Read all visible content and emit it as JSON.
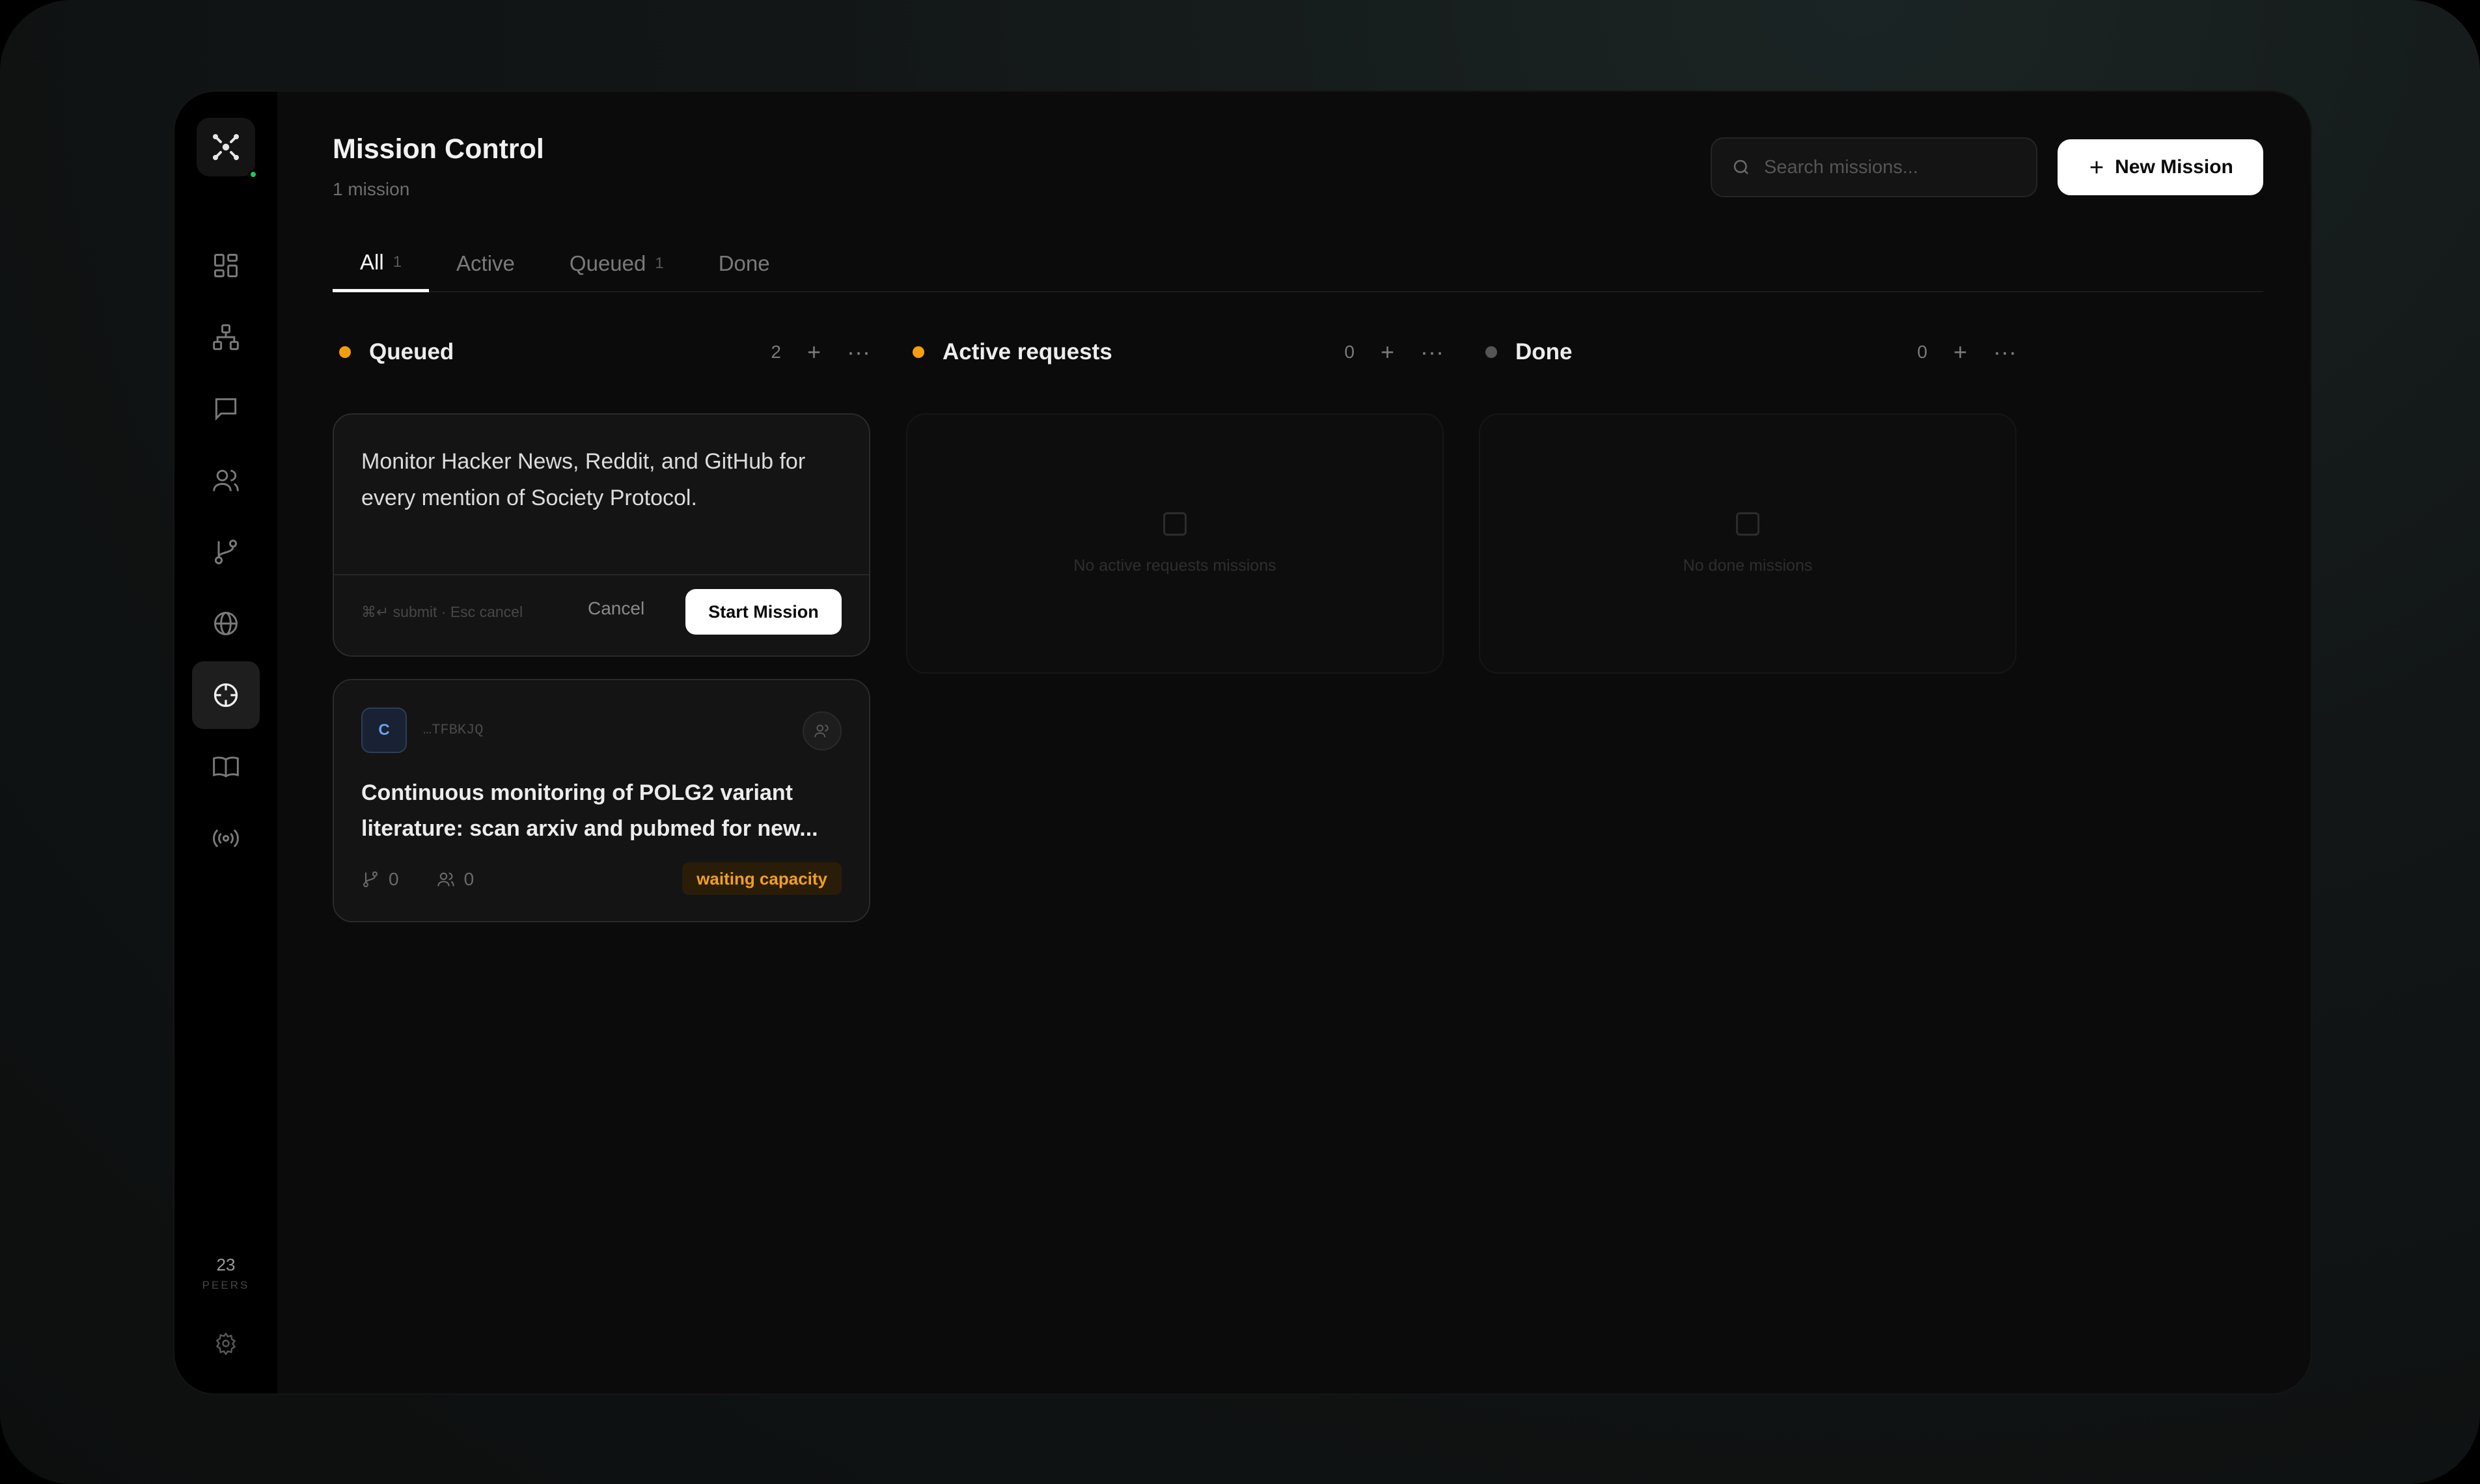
{
  "header": {
    "title": "Mission Control",
    "subtitle": "1 mission",
    "search_placeholder": "Search missions...",
    "new_mission_label": "New Mission"
  },
  "tabs": [
    {
      "label": "All",
      "count": "1"
    },
    {
      "label": "Active",
      "count": ""
    },
    {
      "label": "Queued",
      "count": "1"
    },
    {
      "label": "Done",
      "count": ""
    }
  ],
  "sidebar": {
    "items": [
      {
        "icon": "dashboard-icon"
      },
      {
        "icon": "network-icon"
      },
      {
        "icon": "chat-icon"
      },
      {
        "icon": "users-icon"
      },
      {
        "icon": "git-branch-icon"
      },
      {
        "icon": "globe-icon"
      },
      {
        "icon": "crosshair-icon",
        "active": true
      },
      {
        "icon": "book-icon"
      },
      {
        "icon": "broadcast-icon"
      }
    ],
    "peers_count": "23",
    "peers_label": "PEERS",
    "online_color": "#22c55e"
  },
  "columns": [
    {
      "title": "Queued",
      "count": "2",
      "dot_color": "#f59e0b"
    },
    {
      "title": "Active requests",
      "count": "0",
      "dot_color": "#f59e0b",
      "empty_text": "No active requests missions"
    },
    {
      "title": "Done",
      "count": "0",
      "dot_color": "#555555",
      "empty_text": "No done missions"
    }
  ],
  "draft": {
    "text": "Monitor Hacker News, Reddit, and GitHub for every mention of Society Protocol.",
    "hint": "⌘↵ submit · Esc cancel",
    "cancel_label": "Cancel",
    "start_label": "Start Mission"
  },
  "mission_card": {
    "avatar_letter": "C",
    "mission_id": "…TFBKJQ",
    "title": "Continuous monitoring of POLG2 variant literature: scan arxiv and pubmed for new...",
    "branches": "0",
    "agents": "0",
    "status": "waiting capacity",
    "status_color": "#f0a020"
  }
}
